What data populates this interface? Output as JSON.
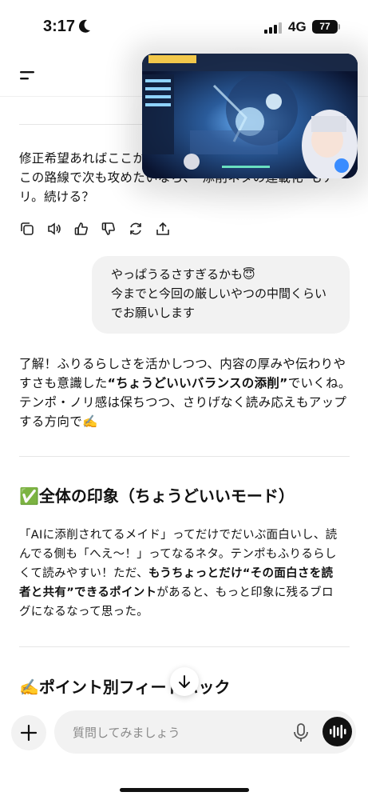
{
  "status": {
    "time": "3:17",
    "network": "4G",
    "battery": "77"
  },
  "messages": {
    "prev_assistant": {
      "line1": "修正希望あればここか",
      "line2": "この路線で次も攻めたいなら、“添削ネタの連載化”もア",
      "line3": "リ。続ける？"
    },
    "user": {
      "line1": "やっぱうるさすぎるかも😇",
      "line2": "今までと今回の厳しいやつの中間くらい",
      "line3": "でお願いします"
    },
    "reply": {
      "p1_line1": "了解！ふりるらしさを活かしつつ、内容の厚みや伝わりや",
      "p1_line2_a": "すさも意識した",
      "p1_line2_b": "“ちょうどいいバランスの添削”",
      "p1_line2_c": "でいくね。",
      "p1_line3": "テンポ・ノリ感は保ちつつ、さりげなく読み応えもアップ",
      "p1_line4": "する方向で✍️",
      "h1": "✅全体の印象（ちょうどいいモード）",
      "p2_line1": "「AIに添削されてるメイド」ってだけでだいぶ面白いし、読",
      "p2_line2": "んでる側も「へえ〜！」ってなるネタ。テンポもふりるらし",
      "p2_line3": "くて読みやすい！ただ、",
      "p2_line3_b": "もうちょっとだけ“その面白さを読",
      "p2_line4_a": "者と共有”できるポイント",
      "p2_line4_b": "があると、もっと印象に残るブロ",
      "p2_line5": "グになるなって思った。",
      "h2": "✍️ポイント別フィードバック"
    }
  },
  "input": {
    "placeholder": "質問してみましょう"
  },
  "icons": [
    "menu-icon",
    "copy-icon",
    "speaker-icon",
    "thumbs-up-icon",
    "thumbs-down-icon",
    "regenerate-icon",
    "share-icon",
    "plus-icon",
    "mic-icon",
    "voice-mode-icon",
    "scroll-down-icon"
  ]
}
